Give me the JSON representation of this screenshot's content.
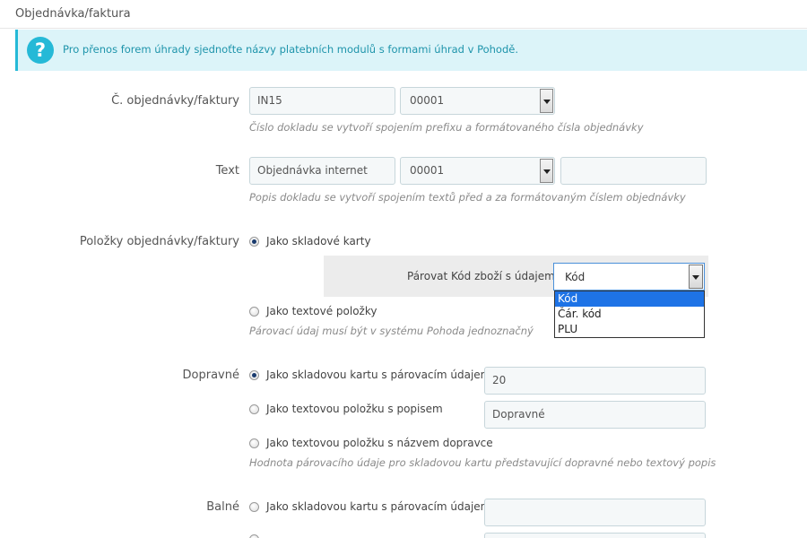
{
  "section": {
    "title": "Objednávka/faktura"
  },
  "alert": {
    "icon": "question-icon",
    "icon_glyph": "?",
    "text": "Pro přenos forem úhrady sjednoťte názvy platebních modulů s formami úhrad v Pohodě."
  },
  "order_number": {
    "label": "Č. objednávky/faktury",
    "prefix_value": "IN15",
    "format_value": "00001",
    "help": "Číslo dokladu se vytvoří spojením prefixu a formátovaného čísla objednávky"
  },
  "text_field": {
    "label": "Text",
    "before_value": "Objednávka internet",
    "format_value": "00001",
    "after_value": "",
    "help": "Popis dokladu se vytvoří spojením textů před a za formátovaným číslem objednávky"
  },
  "order_items": {
    "label": "Položky objednávky/faktury",
    "option_stock": "Jako skladové karty",
    "match_label": "Párovat Kód zboží s údajem",
    "match_selected": "Kód",
    "match_options": [
      "Kód",
      "Čár. kód",
      "PLU"
    ],
    "option_text": "Jako textové položky",
    "help": "Párovací údaj musí být v systému Pohoda jednoznačný"
  },
  "shipping": {
    "label": "Dopravné",
    "option_stock": "Jako skladovou kartu s párovacím údajem",
    "stock_value": "20",
    "option_text_desc": "Jako textovou položku s popisem",
    "text_desc_value": "Dopravné",
    "option_text_carrier": "Jako textovou položku s názvem dopravce",
    "help": "Hodnota párovacího údaje pro skladovou kartu představující dopravné nebo textový popis"
  },
  "packing": {
    "label": "Balné",
    "option_stock": "Jako skladovou kartu s párovacím údajem",
    "stock_value": ""
  },
  "colors": {
    "info_bg": "#dcf4f9",
    "info_accent": "#25b9d7",
    "info_text": "#1e94ab",
    "input_bg": "#f5f8f9",
    "highlight": "#1e73e6"
  }
}
